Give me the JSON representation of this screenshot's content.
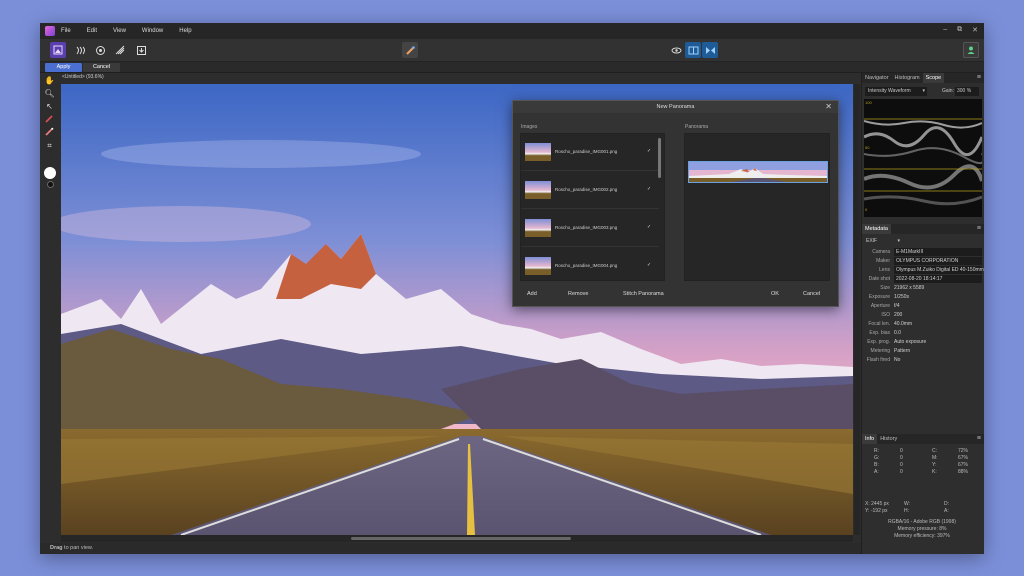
{
  "menu": [
    "File",
    "Edit",
    "View",
    "Window",
    "Help"
  ],
  "window_controls": [
    "–",
    "⧉",
    "✕"
  ],
  "context_bar": {
    "apply": "Apply",
    "cancel": "Cancel"
  },
  "document_title": "<Untitled> (93.6%)",
  "status": {
    "bold": "Drag",
    "text": " to pan view."
  },
  "dialog": {
    "title": "New Panorama",
    "images_label": "Images",
    "panorama_label": "Panorama",
    "images": [
      {
        "name": "Roscho_paradise_IMG001.png"
      },
      {
        "name": "Roscho_paradise_IMG002.png"
      },
      {
        "name": "Roscho_paradise_IMG003.png"
      },
      {
        "name": "Roscho_paradise_IMG004.png"
      }
    ],
    "buttons": {
      "add": "Add",
      "remove": "Remove",
      "stitch": "Stitch Panorama",
      "ok": "OK",
      "cancel": "Cancel"
    }
  },
  "scope_panel": {
    "tabs": [
      "Navigator",
      "Histogram",
      "Scope"
    ],
    "mode": "Intensity Waveform",
    "gain_label": "Gain:",
    "gain_value": "300 %",
    "labels": {
      "top": "100",
      "mid": "50",
      "low": "0"
    }
  },
  "metadata_panel": {
    "tab": "Metadata",
    "type": "EXIF",
    "rows": [
      {
        "k": "Camera",
        "v": "E-M1MarkIII",
        "boxed": true
      },
      {
        "k": "Maker",
        "v": "OLYMPUS CORPORATION",
        "boxed": true
      },
      {
        "k": "Lens",
        "v": "Olympus M.Zuiko Digital ED 40-150mm",
        "boxed": true
      },
      {
        "k": "Date shot",
        "v": "2022-08-20 18:14:17",
        "boxed": true
      },
      {
        "k": "Size",
        "v": "21962 x 5589",
        "boxed": false
      },
      {
        "k": "Exposure",
        "v": "1/250s",
        "boxed": false
      },
      {
        "k": "Aperture",
        "v": "f/4",
        "boxed": false
      },
      {
        "k": "ISO",
        "v": "200",
        "boxed": false
      },
      {
        "k": "Focal len.",
        "v": "40.0mm",
        "boxed": false
      },
      {
        "k": "Exp. bias",
        "v": "0.0",
        "boxed": false
      },
      {
        "k": "Exp. prog.",
        "v": "Auto exposure",
        "boxed": false
      },
      {
        "k": "Metering",
        "v": "Pattern",
        "boxed": false
      },
      {
        "k": "Flash fired",
        "v": "No",
        "boxed": false
      }
    ]
  },
  "info_panel": {
    "tabs": [
      "Info",
      "History"
    ],
    "rgb": [
      {
        "k": "R:",
        "v": "0"
      },
      {
        "k": "G:",
        "v": "0"
      },
      {
        "k": "B:",
        "v": "0"
      },
      {
        "k": "A:",
        "v": "0"
      }
    ],
    "cmyk": [
      {
        "k": "C:",
        "v": "72%"
      },
      {
        "k": "M:",
        "v": "67%"
      },
      {
        "k": "Y:",
        "v": "67%"
      },
      {
        "k": "K:",
        "v": "88%"
      }
    ],
    "x": "X: 2445 px",
    "y": "Y: -192 px",
    "w": "W:",
    "h": "H:",
    "d": "D:",
    "a": "A:",
    "footer": [
      "RGBA/16 - Adobe RGB (1998)",
      "Memory pressure: 8%",
      "Memory efficiency: 397%"
    ]
  },
  "colors": {
    "accent": "#4a6fd1",
    "window_bg": "#2d2d2d",
    "page_bg": "#7b8fd9"
  }
}
